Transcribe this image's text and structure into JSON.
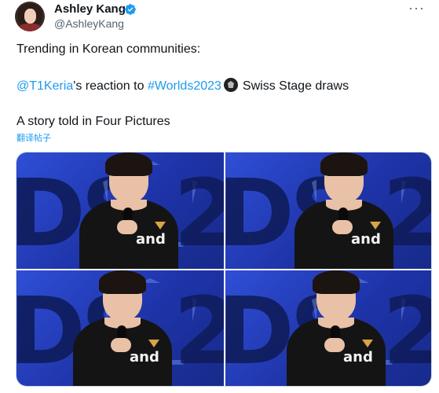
{
  "author": {
    "display_name": "Ashley Kang",
    "handle": "@AshleyKang",
    "verified": true
  },
  "tweet": {
    "line1": "Trending in Korean communities:",
    "mention": "@T1Keria",
    "mid_text": "'s reaction to",
    "hashtag": "#Worlds2023",
    "tail_text": "Swiss Stage draws",
    "line3": "A story told in Four Pictures",
    "translate_label": "翻译帖子"
  },
  "media": {
    "count": 4,
    "jersey_text": "and"
  },
  "colors": {
    "link": "#1d9bf0",
    "verified": "#1d9bf0",
    "stage_blue": "#2f4fd6"
  },
  "icons": {
    "more": "more-horizontal-icon",
    "verified": "verified-badge-icon",
    "worlds": "worlds-trophy-emoji-icon"
  }
}
